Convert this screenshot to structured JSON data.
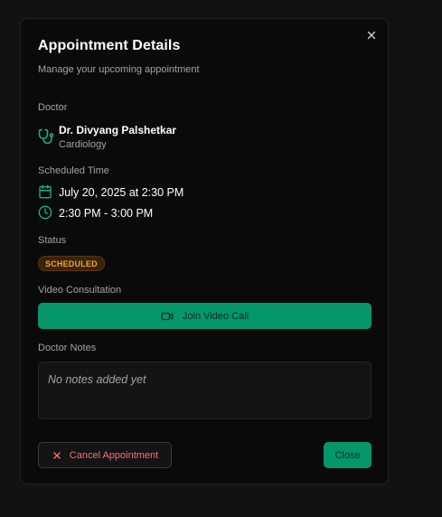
{
  "dialog": {
    "title": "Appointment Details",
    "subtitle": "Manage your upcoming appointment",
    "close_icon": "x-icon"
  },
  "doctor": {
    "section_label": "Doctor",
    "icon": "stethoscope-icon",
    "name": "Dr. Divyang Palshetkar",
    "specialty": "Cardiology"
  },
  "schedule": {
    "section_label": "Scheduled Time",
    "date_icon": "calendar-icon",
    "date": "July 20, 2025 at 2:30 PM",
    "time_icon": "clock-icon",
    "time_range": "2:30 PM - 3:00 PM"
  },
  "status": {
    "section_label": "Status",
    "badge": "SCHEDULED",
    "badge_color": "#f5a524"
  },
  "video": {
    "section_label": "Video Consultation",
    "icon": "video-camera-icon",
    "button_label": "Join Video Call"
  },
  "notes": {
    "section_label": "Doctor Notes",
    "placeholder": "No notes added yet"
  },
  "footer": {
    "cancel_icon": "x-icon",
    "cancel_label": "Cancel Appointment",
    "close_label": "Close"
  },
  "colors": {
    "accent": "#059669",
    "accent_icon": "#10b981",
    "danger": "#f87171"
  }
}
